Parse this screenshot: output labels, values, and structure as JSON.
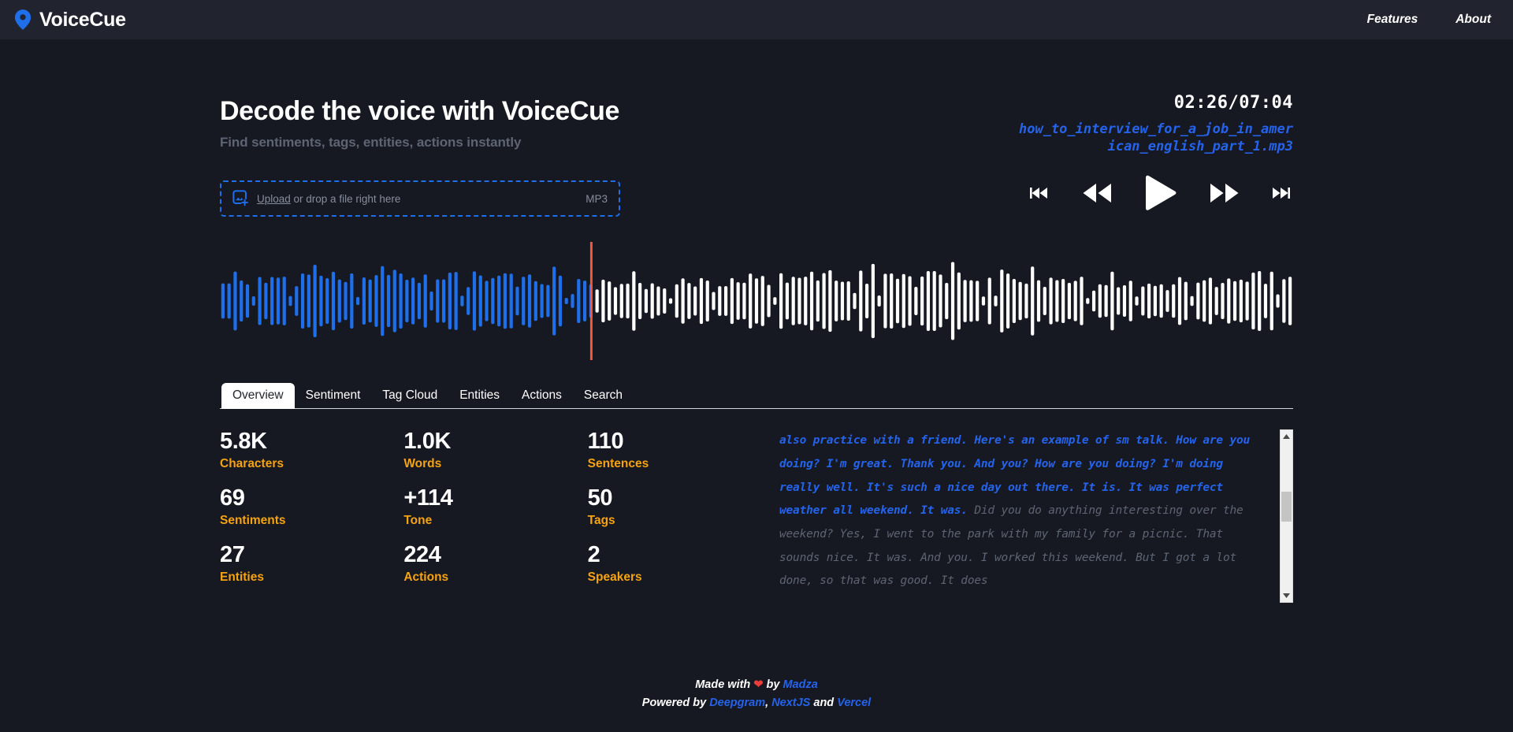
{
  "header": {
    "logo_icon": "map-pin-icon",
    "brand": "VoiceCue",
    "nav": [
      {
        "label": "Features"
      },
      {
        "label": "About"
      }
    ]
  },
  "hero": {
    "title": "Decode the voice with VoiceCue",
    "subtitle": "Find sentiments, tags, entities, actions instantly",
    "dropzone": {
      "icon": "add-image-icon",
      "upload_label": "Upload",
      "rest_label": " or drop a file right here",
      "format": "MP3"
    },
    "player": {
      "timecode": "02:26/07:04",
      "filename": "how_to_interview_for_a_job_in_american_english_part_1.mp3",
      "controls": [
        {
          "name": "skip-back-button",
          "label": "Skip to start"
        },
        {
          "name": "rewind-button",
          "label": "Rewind"
        },
        {
          "name": "play-button",
          "label": "Play"
        },
        {
          "name": "fast-forward-button",
          "label": "Fast forward"
        },
        {
          "name": "skip-forward-button",
          "label": "Skip to end"
        }
      ]
    }
  },
  "waveform": {
    "played_color": "#1f6feb",
    "remaining_color": "#ffffff",
    "playhead_color": "#f4583c",
    "playhead_percent": 34.5
  },
  "tabs": [
    {
      "label": "Overview",
      "active": true
    },
    {
      "label": "Sentiment",
      "active": false
    },
    {
      "label": "Tag Cloud",
      "active": false
    },
    {
      "label": "Entities",
      "active": false
    },
    {
      "label": "Actions",
      "active": false
    },
    {
      "label": "Search",
      "active": false
    }
  ],
  "overview": {
    "stats": [
      {
        "value": "5.8K",
        "label": "Characters"
      },
      {
        "value": "1.0K",
        "label": "Words"
      },
      {
        "value": "110",
        "label": "Sentences"
      },
      {
        "value": "69",
        "label": "Sentiments"
      },
      {
        "value": "+114",
        "label": "Tone"
      },
      {
        "value": "50",
        "label": "Tags"
      },
      {
        "value": "27",
        "label": "Entities"
      },
      {
        "value": "224",
        "label": "Actions"
      },
      {
        "value": "2",
        "label": "Speakers"
      }
    ],
    "transcript": {
      "spoken": "also practice with a friend. Here's an example of sm talk. How are you doing? I'm great. Thank you. And you? How are you doing? I'm doing really well. It's such a nice day out there. It is. It was perfect weather all weekend. It was.",
      "upcoming": " Did you do anything interesting over the weekend? Yes, I went to the park with my family for a picnic. That sounds nice. It was. And you. I worked this weekend. But I got a lot done, so that was good. It does"
    }
  },
  "footer": {
    "made_with": "Made with",
    "heart": "❤",
    "by": "by",
    "author": "Madza",
    "powered_by": "Powered by",
    "tech_1": "Deepgram",
    "comma": ",",
    "tech_2": "NextJS",
    "and": "and",
    "tech_3": "Vercel"
  },
  "colors": {
    "accent_blue": "#1f6feb",
    "accent_orange": "#f5a311",
    "header_bg": "#21242f",
    "body_bg": "#171922"
  }
}
